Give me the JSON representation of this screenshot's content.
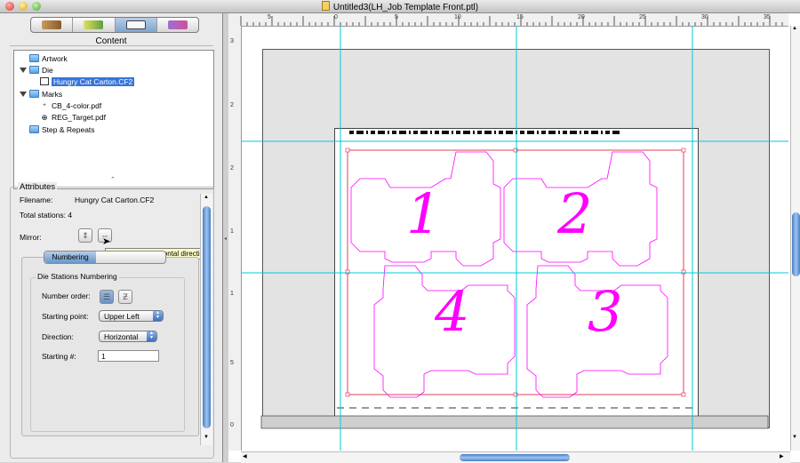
{
  "window": {
    "title": "Untitled3(LH_Job Template Front.ptl)"
  },
  "content_panel": {
    "title": "Content",
    "tree": [
      {
        "label": "Artwork",
        "icon": "folder-icon"
      },
      {
        "label": "Die",
        "icon": "folder-icon",
        "expanded": true
      },
      {
        "label": "Hungry Cat Carton.CF2",
        "icon": "die-icon",
        "selected": true
      },
      {
        "label": "Marks",
        "icon": "folder-icon",
        "expanded": true
      },
      {
        "label": "CB_4-color.pdf",
        "icon": "colorbar-mark-icon"
      },
      {
        "label": "REG_Target.pdf",
        "icon": "registration-target-icon"
      },
      {
        "label": "Step & Repeats",
        "icon": "folder-icon"
      }
    ]
  },
  "attributes": {
    "title": "Attributes",
    "filename_label": "Filename:",
    "filename_value": "Hungry Cat Carton.CF2",
    "total_stations": "Total stations: 4",
    "mirror_label": "Mirror:",
    "tooltip": "Mirror die in horizontal direction",
    "numbering_tab": "Numbering",
    "group_title": "Die Stations Numbering",
    "number_order_label": "Number order:",
    "starting_point_label": "Starting point:",
    "starting_point_value": "Upper Left",
    "direction_label": "Direction:",
    "direction_value": "Horizontal",
    "starting_num_label": "Starting #:",
    "starting_num_value": "1"
  },
  "rulers": {
    "top": [
      "5",
      "0",
      "5",
      "10",
      "15",
      "20",
      "25",
      "30",
      "35"
    ],
    "left": [
      "3",
      "2",
      "2",
      "1",
      "1",
      "5",
      "0"
    ]
  },
  "stations": [
    "1",
    "2",
    "4",
    "3"
  ],
  "colors": {
    "die_line": "#ff00ff",
    "trim_box": "#e0405a",
    "guide": "#00c8d8"
  }
}
